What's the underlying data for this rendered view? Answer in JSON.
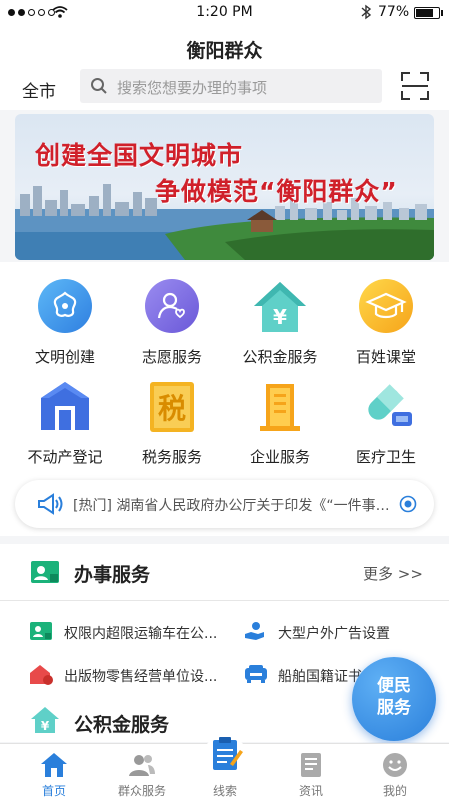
{
  "status_bar": {
    "time": "1:20 PM",
    "battery": "77%",
    "battery_level": 0.77
  },
  "header": {
    "title": "衡阳群众",
    "city": "全市",
    "search_placeholder": "搜索您想要办理的事项"
  },
  "banner": {
    "line1": "创建全国文明城市",
    "line2": "争做模范“衡阳群众”"
  },
  "grid": [
    {
      "label": "文明创建",
      "icon": "flower-icon"
    },
    {
      "label": "志愿服务",
      "icon": "volunteer-icon"
    },
    {
      "label": "公积金服务",
      "icon": "fund-house-icon"
    },
    {
      "label": "百姓课堂",
      "icon": "graduation-cap-icon"
    },
    {
      "label": "不动产登记",
      "icon": "building-icon"
    },
    {
      "label": "税务服务",
      "icon": "tax-icon"
    },
    {
      "label": "企业服务",
      "icon": "enterprise-icon"
    },
    {
      "label": "医疗卫生",
      "icon": "pill-icon"
    }
  ],
  "notice": {
    "text": "[热门] 湖南省人民政府办公厅关于印发《“一件事…"
  },
  "section_banshi": {
    "title": "办事服务",
    "more": "更多 >>",
    "items": [
      "权限内超限运输车在公...",
      "大型户外广告设置",
      "出版物零售经营单位设...",
      "船舶国籍证书"
    ]
  },
  "section_fund": {
    "title": "公积金服务"
  },
  "fab": {
    "line1": "便民",
    "line2": "服务"
  },
  "tabs": [
    {
      "label": "首页",
      "icon": "home-icon"
    },
    {
      "label": "群众服务",
      "icon": "people-icon"
    },
    {
      "label": "线索",
      "icon": "clipboard-icon"
    },
    {
      "label": "资讯",
      "icon": "news-icon"
    },
    {
      "label": "我的",
      "icon": "smile-icon"
    }
  ],
  "colors": {
    "accent": "#2a7fdb",
    "green": "#1bb27a",
    "red": "#d0202a"
  }
}
